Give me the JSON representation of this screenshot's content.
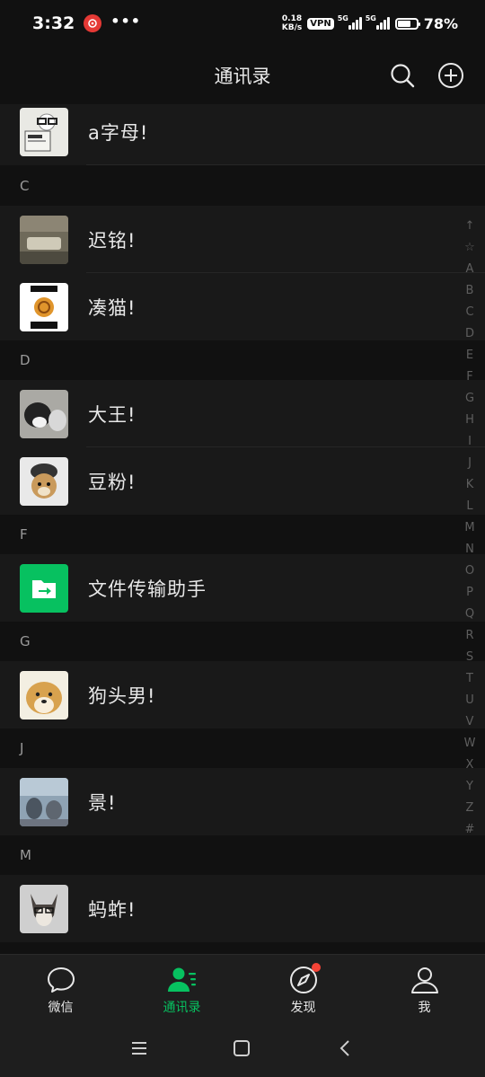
{
  "status_bar": {
    "time": "3:32",
    "speed_value": "0.18",
    "speed_unit": "KB/s",
    "vpn": "VPN",
    "network_1": "5G",
    "network_2": "5G",
    "battery": "78%",
    "battery_level": 0.78
  },
  "nav": {
    "title": "通讯录"
  },
  "list": {
    "top_contact": {
      "name": "a字母!"
    },
    "sections": [
      {
        "letter": "C",
        "contacts": [
          {
            "name": "迟铭!"
          },
          {
            "name": "凑猫!"
          }
        ]
      },
      {
        "letter": "D",
        "contacts": [
          {
            "name": "大王!"
          },
          {
            "name": "豆粉!"
          }
        ]
      },
      {
        "letter": "F",
        "contacts": [
          {
            "name": "文件传输助手"
          }
        ]
      },
      {
        "letter": "G",
        "contacts": [
          {
            "name": "狗头男!"
          }
        ]
      },
      {
        "letter": "J",
        "contacts": [
          {
            "name": "景!"
          }
        ]
      },
      {
        "letter": "M",
        "contacts": [
          {
            "name": "蚂蚱!"
          }
        ]
      }
    ]
  },
  "index_bar": [
    "↑",
    "☆",
    "A",
    "B",
    "C",
    "D",
    "E",
    "F",
    "G",
    "H",
    "I",
    "J",
    "K",
    "L",
    "M",
    "N",
    "O",
    "P",
    "Q",
    "R",
    "S",
    "T",
    "U",
    "V",
    "W",
    "X",
    "Y",
    "Z",
    "#"
  ],
  "tabs": [
    {
      "label": "微信",
      "icon": "chat-bubble-icon"
    },
    {
      "label": "通讯录",
      "icon": "contacts-icon",
      "active": true
    },
    {
      "label": "发现",
      "icon": "compass-icon",
      "badge": "dot"
    },
    {
      "label": "我",
      "icon": "person-icon"
    }
  ],
  "colors": {
    "accent": "#07c160",
    "badge": "#f44336",
    "file_transfer": "#07c160"
  }
}
